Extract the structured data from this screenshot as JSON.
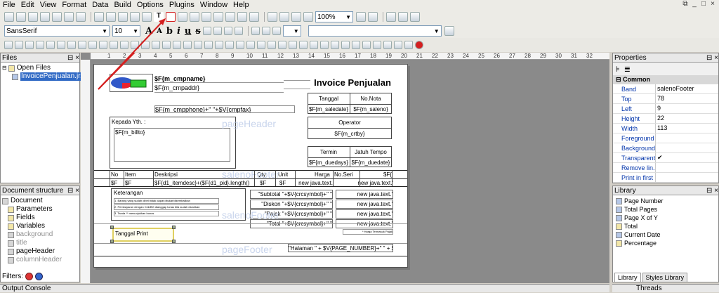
{
  "menu": [
    "File",
    "Edit",
    "View",
    "Format",
    "Data",
    "Build",
    "Options",
    "Plugins",
    "Window",
    "Help"
  ],
  "window_controls": {
    "restore": "⧉",
    "min": "_",
    "max": "□",
    "close": "×"
  },
  "toolbar": {
    "zoom": "100%"
  },
  "format_bar": {
    "font": "SansSerif",
    "size": "10",
    "big_a": "A",
    "small_a": "A",
    "bold": "b",
    "italic": "i",
    "underline": "u",
    "strike": "s"
  },
  "files_panel": {
    "title": "Files",
    "open_files": "Open Files",
    "file": "InvoicePenjualan.jrxml"
  },
  "doc_structure": {
    "title": "Document structure",
    "items": [
      "Document",
      "Parameters",
      "Fields",
      "Variables",
      "background",
      "title",
      "pageHeader",
      "columnHeader"
    ],
    "filters": "Filters:"
  },
  "output_console": "Output Console",
  "threads": "Threads",
  "report": {
    "cmpname": "$F{m_cmpname}",
    "cmpaddr": "$F{m_cmpaddr}",
    "cmpphone": "$F{m_cmpphone}+\" \"+$V{cmpfax}",
    "title": "Invoice Penjualan",
    "tanggal": "Tanggal",
    "nonota": "No.Nota",
    "saledate": "$F{m_saledate}",
    "salenum": "$F{m_saleno}",
    "operator": "Operator",
    "crtby": "$F{m_crtby}",
    "kepada": "Kepada Yth. :",
    "billto": "$F{m_billto}",
    "termin": "Termin",
    "jatuhtempo": "Jatuh Tempo",
    "duedays": "$F{m_duedays}",
    "duedate": "$F{m_duedate}",
    "pageheader_lbl": "pageHeader",
    "col_no": "No",
    "col_item": "Item",
    "col_desc": "Deskripsi",
    "col_qty": "Qty",
    "col_unit": "Unit",
    "col_harga": "Harga",
    "col_noseri": "No.Seri",
    "col_last": "$F{",
    "row_no": "$F",
    "row_item": "$F",
    "row_desc": "$F{d1_itemdesc}+($F{d1_pid}.length()",
    "row_qty": "$F",
    "row_unit": "$F",
    "row_harga": "new java.text.",
    "row_last": "new java.text.'",
    "detail_lbl": "salenoFooter",
    "keterangan": "Keterangan",
    "note1": "1. Barang yang sudah dibeli tidak dapat ditukar/dikembalikan",
    "note2": "2. Pembayaran dengan Cek/BG dianggap lunas bila sudah dicairkan",
    "note3": "3. Tanda ** menunjukkan bonus",
    "subtotal": "\"Subtotal \"+$V{crcsymbol}+\" \"",
    "diskon": "\"Diskon \"+$V{crcsymbol}+\" \"",
    "pajak": "\"Pajak \"+$V{crcsymbol}+\" \"",
    "total": "\"Total \"+$V{crcsymbol}+\" \"",
    "v1": "new java.text.'",
    "v2": "new java.text.'",
    "v3": "new java.text.'",
    "v4": "new java.text.'",
    "harga_note": "* Harga Termasuk Pajak",
    "footer_lbl": "salenoFooter",
    "tanggal_print": "Tanggal Print",
    "pagefooter_lbl": "pageFooter",
    "halaman": "\"Halaman \" + $V{PAGE_NUMBER}+\" \" + $V"
  },
  "ruler_marks": [
    "1",
    "2",
    "3",
    "4",
    "5",
    "6",
    "7",
    "8",
    "9",
    "10",
    "11",
    "12",
    "13",
    "14",
    "15",
    "16",
    "17",
    "18",
    "19",
    "20",
    "21",
    "22",
    "23",
    "24",
    "25",
    "26",
    "27",
    "28",
    "29",
    "30",
    "31",
    "32"
  ],
  "properties": {
    "title": "Properties",
    "section": "Common",
    "rows": [
      {
        "k": "Band",
        "v": "salenoFooter"
      },
      {
        "k": "Top",
        "v": "78"
      },
      {
        "k": "Left",
        "v": "9"
      },
      {
        "k": "Height",
        "v": "22"
      },
      {
        "k": "Width",
        "v": "113"
      },
      {
        "k": "Foreground",
        "v": ""
      },
      {
        "k": "Background",
        "v": ""
      },
      {
        "k": "Transparent",
        "v": "✔"
      },
      {
        "k": "Remove lin...",
        "v": ""
      },
      {
        "k": "Print in first",
        "v": ""
      }
    ]
  },
  "library": {
    "title": "Library",
    "items": [
      "Page Number",
      "Total Pages",
      "Page X of Y",
      "Total",
      "Current Date",
      "Percentage"
    ],
    "tabs": [
      "Library",
      "Styles Library"
    ]
  },
  "colors": {
    "accent": "#0a246a",
    "arrow": "#d42020"
  }
}
